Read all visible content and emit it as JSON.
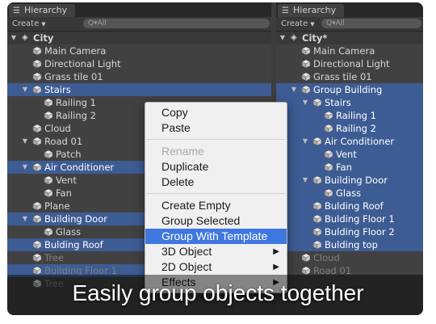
{
  "left_panel": {
    "tab_label": "Hierarchy",
    "create_label": "Create",
    "search_placeholder": "Q▾All",
    "scene_name": "City",
    "rows": [
      {
        "label": "Main Camera",
        "depth": 1,
        "arrow": "",
        "state": "normal"
      },
      {
        "label": "Directional Light",
        "depth": 1,
        "arrow": "",
        "state": "normal"
      },
      {
        "label": "Grass tile 01",
        "depth": 1,
        "arrow": "",
        "state": "normal"
      },
      {
        "label": "Stairs",
        "depth": 1,
        "arrow": "▼",
        "state": "selected"
      },
      {
        "label": "Railing 1",
        "depth": 2,
        "arrow": "",
        "state": "normal"
      },
      {
        "label": "Railing 2",
        "depth": 2,
        "arrow": "",
        "state": "normal"
      },
      {
        "label": "Cloud",
        "depth": 1,
        "arrow": "",
        "state": "normal"
      },
      {
        "label": "Road 01",
        "depth": 1,
        "arrow": "▼",
        "state": "normal"
      },
      {
        "label": "Patch",
        "depth": 2,
        "arrow": "",
        "state": "normal"
      },
      {
        "label": "Air Conditioner",
        "depth": 1,
        "arrow": "▼",
        "state": "selected"
      },
      {
        "label": "Vent",
        "depth": 2,
        "arrow": "",
        "state": "normal"
      },
      {
        "label": "Fan",
        "depth": 2,
        "arrow": "",
        "state": "normal"
      },
      {
        "label": "Plane",
        "depth": 1,
        "arrow": "",
        "state": "normal"
      },
      {
        "label": "Building Door",
        "depth": 1,
        "arrow": "▼",
        "state": "selected"
      },
      {
        "label": "Glass",
        "depth": 2,
        "arrow": "",
        "state": "normal"
      },
      {
        "label": "Bulding Roof",
        "depth": 1,
        "arrow": "",
        "state": "selected"
      },
      {
        "label": "Tree",
        "depth": 1,
        "arrow": "",
        "state": "dim"
      },
      {
        "label": "Building Floor 1",
        "depth": 1,
        "arrow": "",
        "state": "selected-dim"
      },
      {
        "label": "Tree",
        "depth": 1,
        "arrow": "",
        "state": "dim"
      }
    ]
  },
  "right_panel": {
    "tab_label": "Hierarchy",
    "create_label": "Create",
    "search_placeholder": "Q▾All",
    "scene_name": "City*",
    "rows": [
      {
        "label": "Main Camera",
        "depth": 1,
        "arrow": "",
        "state": "normal"
      },
      {
        "label": "Directional Light",
        "depth": 1,
        "arrow": "",
        "state": "normal"
      },
      {
        "label": "Grass tile 01",
        "depth": 1,
        "arrow": "",
        "state": "normal"
      },
      {
        "label": "Group Building",
        "depth": 1,
        "arrow": "▼",
        "state": "selected"
      },
      {
        "label": "Stairs",
        "depth": 2,
        "arrow": "▼",
        "state": "selected"
      },
      {
        "label": "Railing 1",
        "depth": 3,
        "arrow": "",
        "state": "selected"
      },
      {
        "label": "Railing 2",
        "depth": 3,
        "arrow": "",
        "state": "selected"
      },
      {
        "label": "Air Conditioner",
        "depth": 2,
        "arrow": "▼",
        "state": "selected"
      },
      {
        "label": "Vent",
        "depth": 3,
        "arrow": "",
        "state": "selected"
      },
      {
        "label": "Fan",
        "depth": 3,
        "arrow": "",
        "state": "selected"
      },
      {
        "label": "Building Door",
        "depth": 2,
        "arrow": "▼",
        "state": "selected"
      },
      {
        "label": "Glass",
        "depth": 3,
        "arrow": "",
        "state": "selected"
      },
      {
        "label": "Bulding Roof",
        "depth": 2,
        "arrow": "",
        "state": "selected"
      },
      {
        "label": "Bulding Floor 1",
        "depth": 2,
        "arrow": "",
        "state": "selected"
      },
      {
        "label": "Bulding Floor 2",
        "depth": 2,
        "arrow": "",
        "state": "selected"
      },
      {
        "label": "Bulding top",
        "depth": 2,
        "arrow": "",
        "state": "selected"
      },
      {
        "label": "Cloud",
        "depth": 1,
        "arrow": "",
        "state": "dim"
      },
      {
        "label": "Road 01",
        "depth": 1,
        "arrow": "",
        "state": "dim"
      }
    ]
  },
  "context_menu": {
    "items": [
      {
        "label": "Copy",
        "state": "normal",
        "submenu": false
      },
      {
        "label": "Paste",
        "state": "normal",
        "submenu": false
      },
      {
        "label": "",
        "state": "separator",
        "submenu": false
      },
      {
        "label": "Rename",
        "state": "disabled",
        "submenu": false
      },
      {
        "label": "Duplicate",
        "state": "normal",
        "submenu": false
      },
      {
        "label": "Delete",
        "state": "normal",
        "submenu": false
      },
      {
        "label": "",
        "state": "separator",
        "submenu": false
      },
      {
        "label": "Create Empty",
        "state": "normal",
        "submenu": false
      },
      {
        "label": "Group Selected",
        "state": "normal",
        "submenu": false
      },
      {
        "label": "Group With Template",
        "state": "highlighted",
        "submenu": false
      },
      {
        "label": "3D Object",
        "state": "normal",
        "submenu": true
      },
      {
        "label": "2D Object",
        "state": "normal",
        "submenu": true
      },
      {
        "label": "Effects",
        "state": "normal",
        "submenu": true
      }
    ],
    "submenu_arrow": "▶"
  },
  "caption": "Easily group objects together",
  "icons": {
    "tab": "hierarchy-list-icon",
    "scene": "unity-scene-icon",
    "object": "gameobject-cube-icon"
  },
  "colors": {
    "selection": "#3d5c93",
    "menu_highlight": "#3f77e0",
    "panel_bg": "#414141"
  }
}
